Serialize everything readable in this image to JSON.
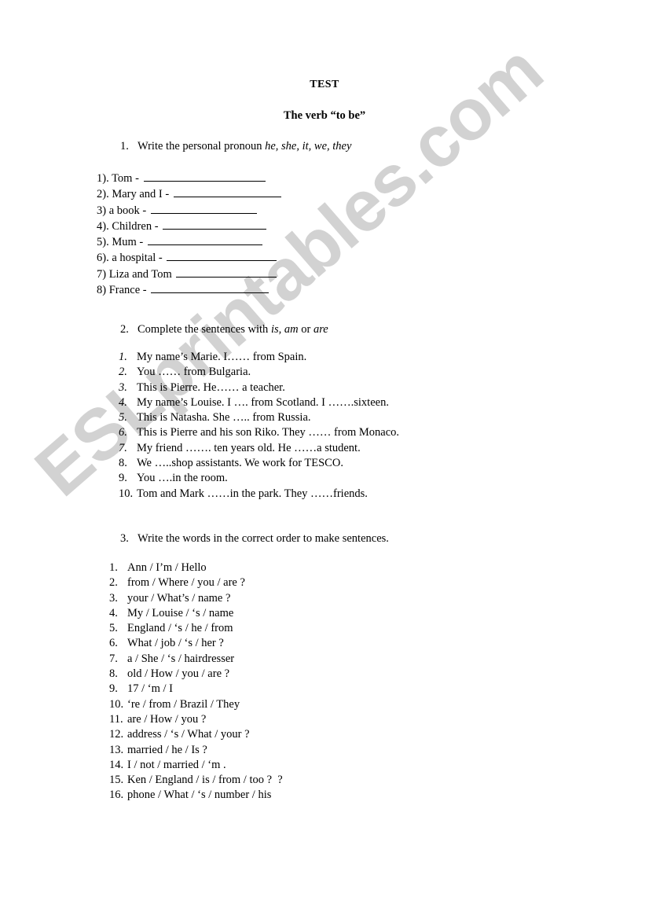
{
  "document": {
    "title": "TEST",
    "subtitle": "The verb “to be”",
    "watermark": "ESLprintables.com",
    "watermark_color": "#d2d2d2"
  },
  "exercise1": {
    "number": "1.",
    "instruction_before": "Write the personal pronoun ",
    "instruction_italic": "he, she, it, we, they",
    "items": [
      {
        "label": "1). Tom - ",
        "blank_width": 155
      },
      {
        "label": "2). Mary and I - ",
        "blank_width": 137
      },
      {
        "label": "3) a book - ",
        "blank_width": 135
      },
      {
        "label": "4). Children - ",
        "blank_width": 132
      },
      {
        "label": "5). Mum - ",
        "blank_width": 146
      },
      {
        "label": "6). a hospital - ",
        "blank_width": 140
      },
      {
        "label": "7) Liza and Tom ",
        "blank_width": 128
      },
      {
        "label": "8) France - ",
        "blank_width": 150
      }
    ]
  },
  "exercise2": {
    "number": "2.",
    "instruction_before": "Complete the sentences with ",
    "instruction_italic1": "is, am",
    "instruction_middle": " or ",
    "instruction_italic2": "are",
    "items": [
      {
        "num": "1.",
        "italic": true,
        "text": "My name’s Marie. I…… from Spain."
      },
      {
        "num": "2.",
        "italic": true,
        "text": "You …… from Bulgaria."
      },
      {
        "num": "3.",
        "italic": true,
        "text": "This is Pierre. He…… a teacher."
      },
      {
        "num": "4.",
        "italic": true,
        "text": "My name’s Louise. I …. from Scotland. I …….sixteen."
      },
      {
        "num": "5.",
        "italic": true,
        "text": "This is Natasha. She ….. from Russia."
      },
      {
        "num": "6.",
        "italic": true,
        "text": "This is Pierre and his son Riko. They …… from Monaco."
      },
      {
        "num": "7.",
        "italic": true,
        "text": "My friend ……. ten years old. He ……a student."
      },
      {
        "num": "8.",
        "italic": false,
        "text": "We …..shop assistants. We work for TESCO."
      },
      {
        "num": "9.",
        "italic": false,
        "text": "You ….in the room."
      },
      {
        "num": "10.",
        "italic": false,
        "text": "Tom and Mark ……in the park. They ……friends."
      }
    ]
  },
  "exercise3": {
    "number": "3.",
    "instruction": "Write the words in the correct order to make sentences.",
    "items": [
      {
        "num": "1.",
        "text": "Ann / I’m / Hello"
      },
      {
        "num": "2.",
        "text": "from / Where / you / are ?"
      },
      {
        "num": "3.",
        "text": "your / What’s / name ?"
      },
      {
        "num": "4.",
        "text": "My / Louise / ‘s / name"
      },
      {
        "num": "5.",
        "text": "England / ‘s / he / from"
      },
      {
        "num": "6.",
        "text": "What / job / ‘s / her ?"
      },
      {
        "num": "7.",
        "text": "a / She / ‘s / hairdresser"
      },
      {
        "num": "8.",
        "text": "old / How / you / are ?"
      },
      {
        "num": "9.",
        "text": "17 / ‘m / I"
      },
      {
        "num": "10.",
        "text": "‘re / from / Brazil / They"
      },
      {
        "num": "11.",
        "text": "are / How / you ?"
      },
      {
        "num": "12.",
        "text": "address / ‘s / What / your ?"
      },
      {
        "num": "13.",
        "text": "married / he / Is ?"
      },
      {
        "num": "14.",
        "text": "I / not / married / ‘m ."
      },
      {
        "num": "15.",
        "text": "Ken / England / is / from / too ?  ?"
      },
      {
        "num": "16.",
        "text": "phone / What / ‘s / number / his"
      }
    ]
  }
}
